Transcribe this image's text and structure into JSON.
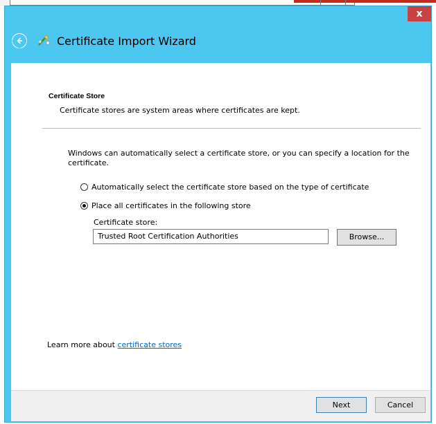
{
  "window": {
    "title": "Certificate Import Wizard",
    "close_glyph": "x",
    "colors": {
      "frame": "#4cc7ef",
      "close": "#c74343",
      "link": "#0066cc"
    }
  },
  "icons": {
    "back": "back-arrow-icon",
    "wizard": "certificate-wizard-icon",
    "close": "close-icon"
  },
  "page": {
    "section_title": "Certificate Store",
    "section_description": "Certificate stores are system areas where certificates are kept.",
    "intro": "Windows can automatically select a certificate store, or you can specify a location for the certificate.",
    "options": [
      {
        "label": "Automatically select the certificate store based on the type of certificate",
        "checked": false
      },
      {
        "label": "Place all certificates in the following store",
        "checked": true
      }
    ],
    "store_label": "Certificate store:",
    "store_value": "Trusted Root Certification Authorities",
    "browse_label": "Browse...",
    "learn_prefix": "Learn more about ",
    "learn_link": "certificate stores"
  },
  "footer": {
    "next_label": "Next",
    "cancel_label": "Cancel"
  }
}
